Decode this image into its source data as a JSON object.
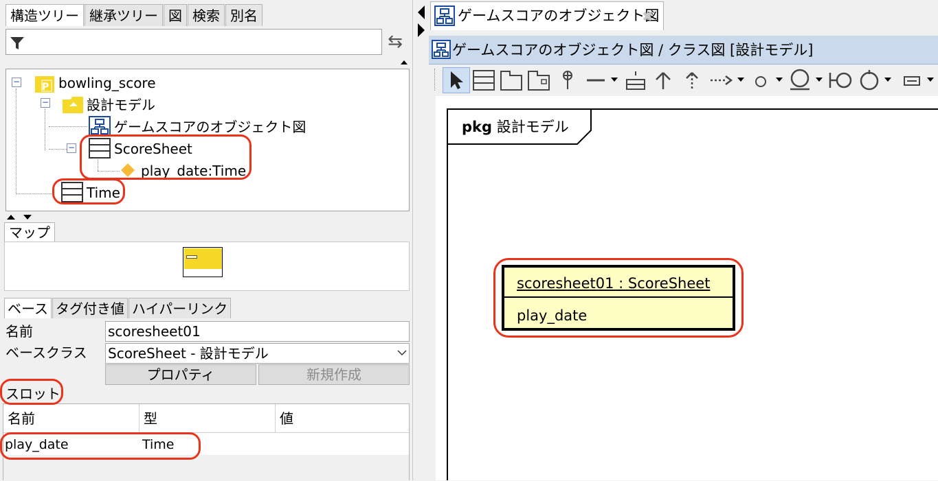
{
  "left_panel": {
    "tabs": [
      "構造ツリー",
      "継承ツリー",
      "図",
      "検索",
      "別名"
    ],
    "tree": {
      "root": "bowling_score",
      "model": "設計モデル",
      "diagram": "ゲームスコアのオブジェクト図",
      "class1": "ScoreSheet",
      "attr": "play_date:Time",
      "class2": "Time"
    },
    "map_tab": "マップ",
    "prop_tabs": [
      "ベース",
      "タグ付き値",
      "ハイパーリンク"
    ],
    "props": {
      "name_label": "名前",
      "name_value": "scoresheet01",
      "baseclass_label": "ベースクラス",
      "baseclass_value": "ScoreSheet - 設計モデル",
      "property_button": "プロパティ",
      "new_button": "新規作成",
      "slot_label": "スロット"
    },
    "slot_table": {
      "headers": [
        "名前",
        "型",
        "値"
      ],
      "rows": [
        {
          "name": "play_date",
          "type": "Time",
          "value": ""
        }
      ]
    }
  },
  "right_panel": {
    "doc_tab": "ゲームスコアのオブジェクト図",
    "header_title": "ゲームスコアのオブジェクト図 / クラス図 [設計モデル]",
    "package": {
      "keyword": "pkg",
      "name": "設計モデル"
    },
    "object": {
      "name": "scoresheet01 : ScoreSheet",
      "slot": "play_date"
    }
  },
  "colors": {
    "highlight_ring": "#e8341c",
    "object_fill": "#fdfdc4",
    "folder": "#f6d928",
    "header": "#cad9ec"
  }
}
